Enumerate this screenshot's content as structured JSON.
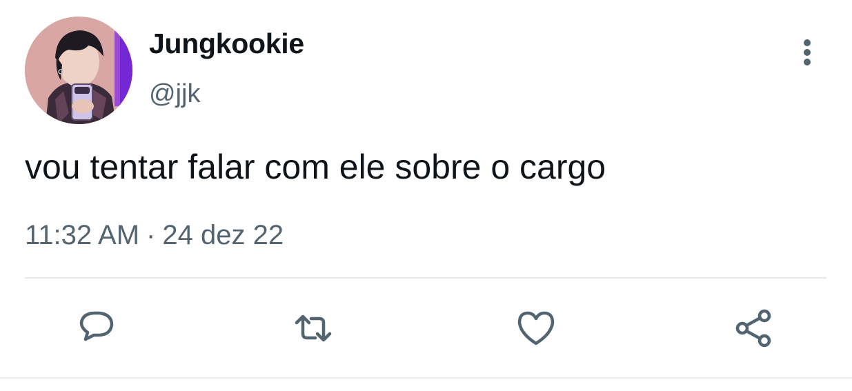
{
  "author": {
    "display_name": "Jungkookie",
    "handle": "@jjk",
    "avatar_icon": "profile-photo"
  },
  "tweet": {
    "text": "vou tentar falar com ele sobre o cargo",
    "time": "11:32 AM",
    "separator": "·",
    "date": "24 dez 22"
  },
  "actions": [
    {
      "name": "reply",
      "icon": "speech-bubble-icon"
    },
    {
      "name": "retweet",
      "icon": "retweet-arrows-icon"
    },
    {
      "name": "like",
      "icon": "heart-icon"
    },
    {
      "name": "share",
      "icon": "share-nodes-icon"
    }
  ],
  "menu": {
    "icon": "vertical-dots-icon"
  },
  "colors": {
    "text_primary": "#0f1419",
    "text_secondary": "#536471",
    "icon": "#536471",
    "divider": "#e6e9eb"
  }
}
